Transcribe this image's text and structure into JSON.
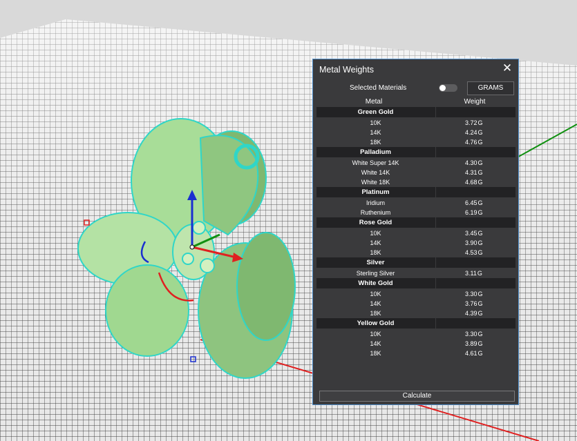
{
  "panel": {
    "title": "Metal Weights",
    "selected_materials_label": "Selected Materials",
    "selected_materials_on": false,
    "units_button": "GRAMS",
    "col_metal": "Metal",
    "col_weight": "Weight",
    "calculate_label": "Calculate",
    "unit": "G",
    "groups": [
      {
        "name": "Green Gold",
        "rows": [
          {
            "metal": "10K",
            "weight": "3.72"
          },
          {
            "metal": "14K",
            "weight": "4.24"
          },
          {
            "metal": "18K",
            "weight": "4.76"
          }
        ]
      },
      {
        "name": "Palladium",
        "rows": [
          {
            "metal": "White Super 14K",
            "weight": "4.30"
          },
          {
            "metal": "White 14K",
            "weight": "4.31"
          },
          {
            "metal": "White 18K",
            "weight": "4.68"
          }
        ]
      },
      {
        "name": "Platinum",
        "rows": [
          {
            "metal": "Iridium",
            "weight": "6.45"
          },
          {
            "metal": "Ruthenium",
            "weight": "6.19"
          }
        ]
      },
      {
        "name": "Rose Gold",
        "rows": [
          {
            "metal": "10K",
            "weight": "3.45"
          },
          {
            "metal": "14K",
            "weight": "3.90"
          },
          {
            "metal": "18K",
            "weight": "4.53"
          }
        ]
      },
      {
        "name": "Silver",
        "rows": [
          {
            "metal": "Sterling Silver",
            "weight": "3.11"
          }
        ]
      },
      {
        "name": "White Gold",
        "rows": [
          {
            "metal": "10K",
            "weight": "3.30"
          },
          {
            "metal": "14K",
            "weight": "3.76"
          },
          {
            "metal": "18K",
            "weight": "4.39"
          }
        ]
      },
      {
        "name": "Yellow Gold",
        "rows": [
          {
            "metal": "10K",
            "weight": "3.30"
          },
          {
            "metal": "14K",
            "weight": "3.89"
          },
          {
            "metal": "18K",
            "weight": "4.61"
          }
        ]
      }
    ]
  },
  "viewport": {
    "model_color": "#9fd98f",
    "edge_color": "#2fd6c8",
    "grid_color": "#3d3d3d",
    "axis_x_color": "#e02020",
    "axis_y_color": "#109010",
    "axis_z_color": "#1a2fd0"
  }
}
